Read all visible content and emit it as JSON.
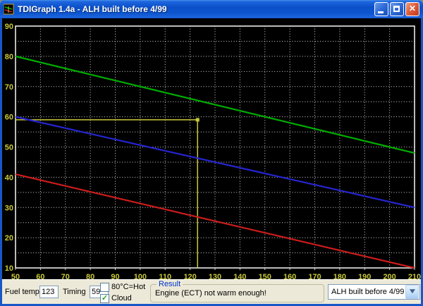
{
  "window": {
    "title": "TDIGraph 1.4a - ALH built before 4/99",
    "buttons": {
      "minimize": "minimize",
      "maximize": "maximize",
      "close": "close"
    }
  },
  "colors": {
    "title_bar": "#0C55CF",
    "plot_background": "#000000",
    "grid": "#D4D4D4",
    "axis_label": "#C9C93A",
    "green_line": "#00AE00",
    "blue_line": "#2525CE",
    "red_line": "#CC1C1C",
    "crosshair": "#C9C93A",
    "panel": "#ECE9D8"
  },
  "chart_data": {
    "type": "line",
    "title": "",
    "xlabel": "Fuel temp",
    "ylabel": "Timing",
    "x_range": [
      50,
      210
    ],
    "y_range": [
      10,
      90
    ],
    "x_ticks": [
      50,
      60,
      70,
      80,
      90,
      100,
      110,
      120,
      130,
      140,
      150,
      160,
      170,
      180,
      190,
      200,
      210
    ],
    "y_ticks": [
      90,
      80,
      70,
      60,
      50,
      40,
      30,
      20,
      10
    ],
    "grid": {
      "vertical_every": 10,
      "horizontal_every": 5,
      "style": "dotted"
    },
    "legend": "none",
    "series": [
      {
        "name": "green",
        "color": "#00AE00",
        "points": [
          [
            50,
            80
          ],
          [
            210,
            48
          ]
        ]
      },
      {
        "name": "blue",
        "color": "#2525CE",
        "points": [
          [
            50,
            60
          ],
          [
            210,
            30
          ]
        ]
      },
      {
        "name": "red",
        "color": "#CC1C1C",
        "points": [
          [
            50,
            41
          ],
          [
            210,
            10
          ]
        ]
      }
    ],
    "crosshair": {
      "x": 123,
      "y": 59,
      "color": "#C9C93A"
    }
  },
  "controls": {
    "fuel_temp_label": "Fuel temp",
    "fuel_temp_value": "123",
    "timing_label": "Timing",
    "timing_value": "59",
    "checkbox_hot": {
      "label": "80°C=Hot",
      "checked": false,
      "glyph": ""
    },
    "checkbox_cloud": {
      "label": "Cloud",
      "checked": true,
      "glyph": "✓"
    },
    "result_group_label": "Result",
    "result_text": "Engine (ECT) not warm enough!",
    "model_dropdown_value": "ALH built before 4/99",
    "dropdown_chevron": "▼"
  }
}
